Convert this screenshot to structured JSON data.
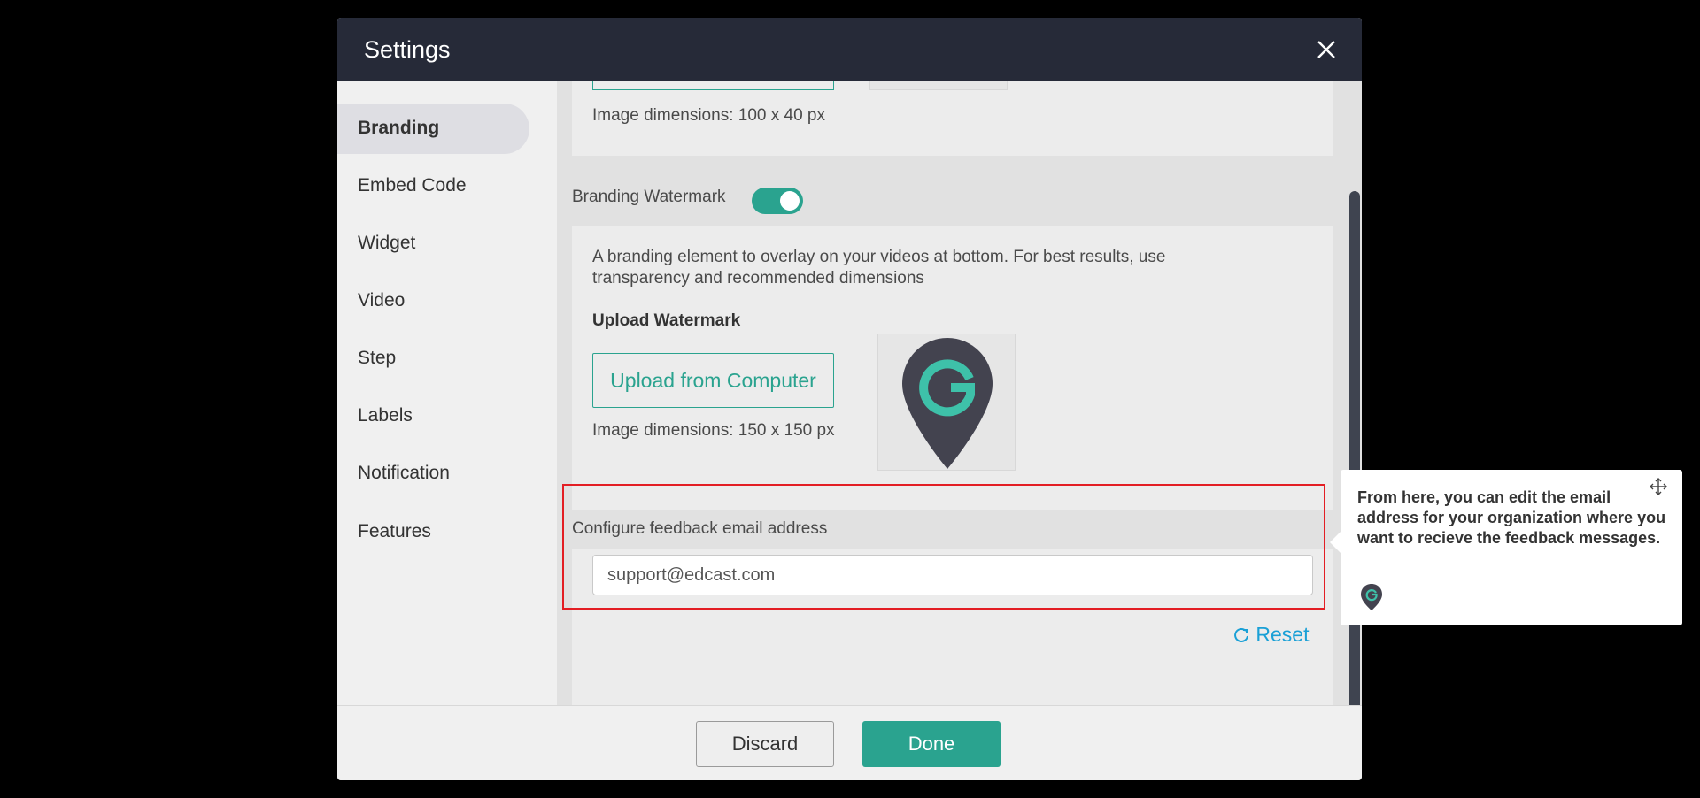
{
  "modal": {
    "title": "Settings",
    "close_icon": "close-icon"
  },
  "sidebar": {
    "items": [
      {
        "label": "Branding",
        "active": true
      },
      {
        "label": "Embed Code"
      },
      {
        "label": "Widget"
      },
      {
        "label": "Video"
      },
      {
        "label": "Step"
      },
      {
        "label": "Labels"
      },
      {
        "label": "Notification"
      },
      {
        "label": "Features"
      }
    ]
  },
  "logo_section": {
    "dimensions_text": "Image dimensions: 100 x 40 px"
  },
  "watermark": {
    "label": "Branding Watermark",
    "toggle_on": true,
    "description": "A branding element to overlay on your videos at bottom. For best results, use transparency and recommended dimensions",
    "upload_title": "Upload Watermark",
    "upload_button": "Upload from Computer",
    "dimensions_text": "Image dimensions: 150 x 150 px",
    "thumbnail_icon": "map-pin-logo-icon"
  },
  "feedback": {
    "label": "Configure feedback email address",
    "email_value": "support@edcast.com",
    "reset_label": "Reset",
    "reset_icon": "refresh-icon"
  },
  "footer": {
    "discard_label": "Discard",
    "done_label": "Done"
  },
  "tooltip": {
    "text": "From here, you can edit the email address for your organization where you want to recieve the feedback messages.",
    "move_icon": "move-icon",
    "logo_icon": "guide-logo-icon"
  },
  "colors": {
    "accent": "#2aa38f",
    "header_bg": "#262a38",
    "highlight": "#e31e24",
    "link": "#1aa0d6"
  }
}
